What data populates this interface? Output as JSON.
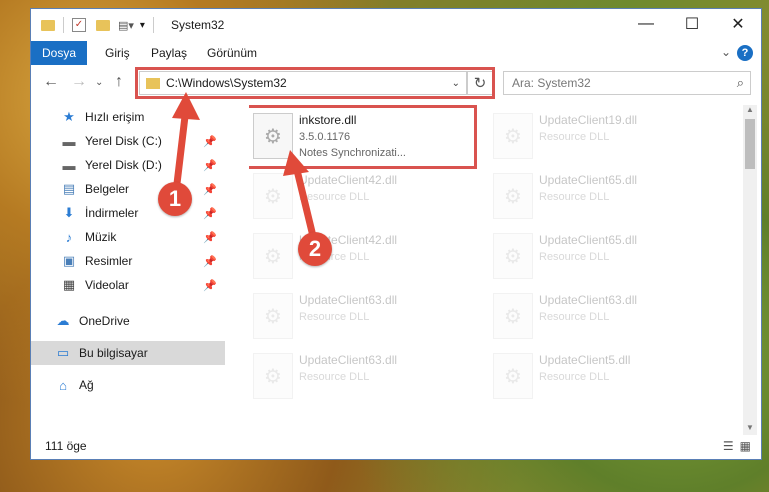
{
  "titlebar": {
    "title": "System32",
    "minimize": "—",
    "maximize": "☐",
    "close": "✕"
  },
  "menu": {
    "file": "Dosya",
    "home": "Giriş",
    "share": "Paylaş",
    "view": "Görünüm",
    "expand": "⌄",
    "help": "?"
  },
  "nav": {
    "back": "←",
    "forward": "→",
    "dropdown": "⌄",
    "up": "↑",
    "path": "C:\\Windows\\System32",
    "addr_dropdown": "⌄",
    "refresh": "↻",
    "search_placeholder": "Ara: System32"
  },
  "sidebar": {
    "items": [
      {
        "label": "Hızlı erişim",
        "icon": "star-icon"
      },
      {
        "label": "Yerel Disk (C:)",
        "icon": "drive-icon",
        "pinned": true
      },
      {
        "label": "Yerel Disk (D:)",
        "icon": "drive-icon",
        "pinned": true
      },
      {
        "label": "Belgeler",
        "icon": "documents-icon",
        "pinned": true
      },
      {
        "label": "İndirmeler",
        "icon": "downloads-icon",
        "pinned": true
      },
      {
        "label": "Müzik",
        "icon": "music-icon",
        "pinned": true
      },
      {
        "label": "Resimler",
        "icon": "pictures-icon",
        "pinned": true
      },
      {
        "label": "Videolar",
        "icon": "videos-icon",
        "pinned": true
      },
      {
        "label": "OneDrive",
        "icon": "cloud-icon"
      },
      {
        "label": "Bu bilgisayar",
        "icon": "computer-icon",
        "selected": true
      },
      {
        "label": "Ağ",
        "icon": "network-icon"
      }
    ]
  },
  "files": [
    {
      "name": "inkstore.dll",
      "version": "3.5.0.1176",
      "desc": "Notes Synchronizati..."
    },
    {
      "name": "UpdateClient19.dll",
      "desc": "Resource DLL"
    },
    {
      "name": "UpdateClient42.dll",
      "desc": "Resource DLL"
    },
    {
      "name": "UpdateClient65.dll",
      "desc": "Resource DLL"
    },
    {
      "name": "UpdateClient42.dll",
      "desc": "Resource DLL"
    },
    {
      "name": "UpdateClient65.dll",
      "desc": "Resource DLL"
    },
    {
      "name": "UpdateClient63.dll",
      "desc": "Resource DLL"
    },
    {
      "name": "UpdateClient63.dll",
      "desc": "Resource DLL"
    },
    {
      "name": "UpdateClient63.dll",
      "desc": "Resource DLL"
    },
    {
      "name": "UpdateClient5.dll",
      "desc": "Resource DLL"
    }
  ],
  "status": {
    "count": "111 öge"
  },
  "callouts": {
    "one": "1",
    "two": "2"
  },
  "colors": {
    "accent": "#1a6fc4",
    "highlight": "#d9534f",
    "callout": "#e04a3a"
  }
}
